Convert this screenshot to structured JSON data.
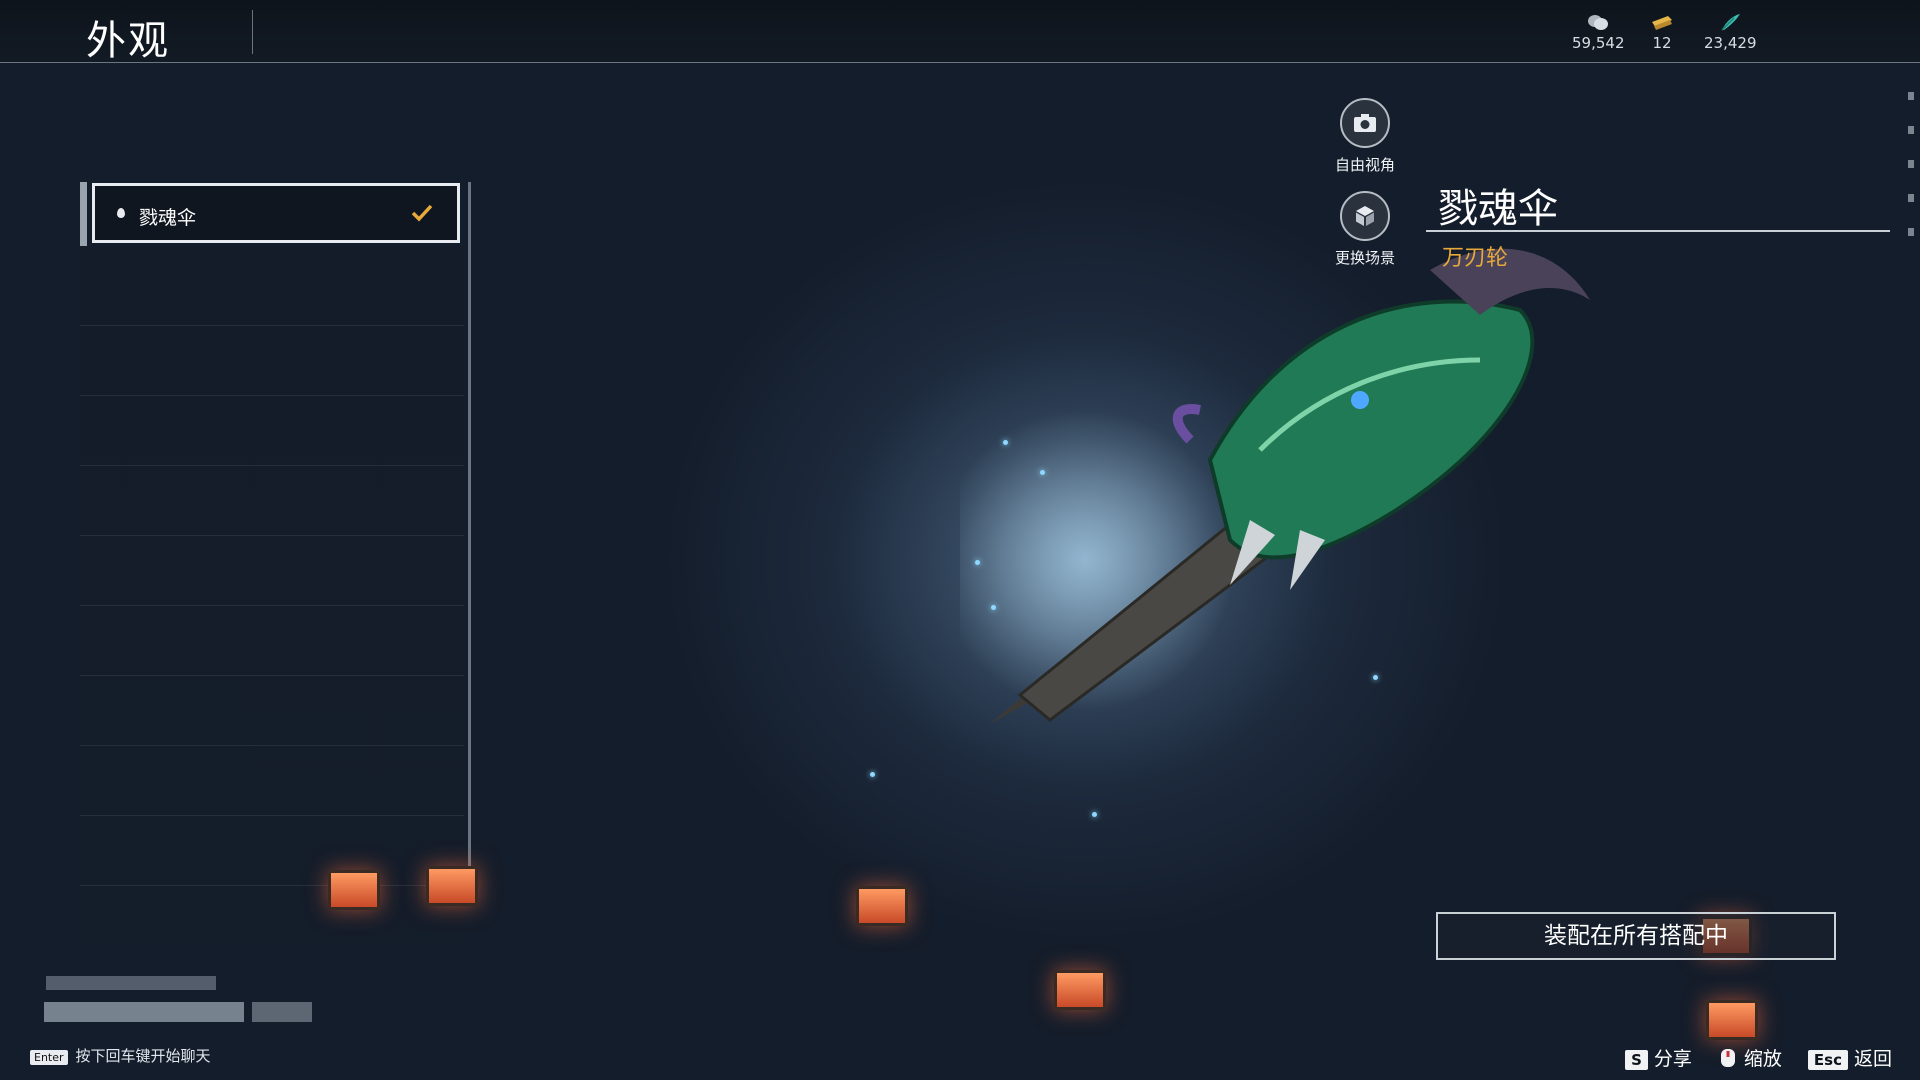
{
  "header": {
    "title": "外观",
    "currencies": [
      {
        "icon": "silver-coin-icon",
        "value": "59,542",
        "color": "#c9d1d8"
      },
      {
        "icon": "gold-ticket-icon",
        "value": "12",
        "color": "#e6b64a"
      },
      {
        "icon": "jade-feather-icon",
        "value": "23,429",
        "color": "#37c0b0"
      }
    ]
  },
  "list": {
    "items": [
      {
        "label": "戮魂伞",
        "selected": true,
        "equipped": true
      }
    ]
  },
  "view_controls": {
    "free_view": "自由视角",
    "change_scene": "更换场景"
  },
  "detail": {
    "name": "戮魂伞",
    "subtitle": "万刃轮",
    "equip_all": "装配在所有搭配中",
    "accent_color": "#e6a93a"
  },
  "chat": {
    "enter_key": "Enter",
    "hint": "按下回车键开始聊天"
  },
  "footer": {
    "share_key": "S",
    "share_label": "分享",
    "zoom_label": "缩放",
    "back_key": "Esc",
    "back_label": "返回"
  }
}
